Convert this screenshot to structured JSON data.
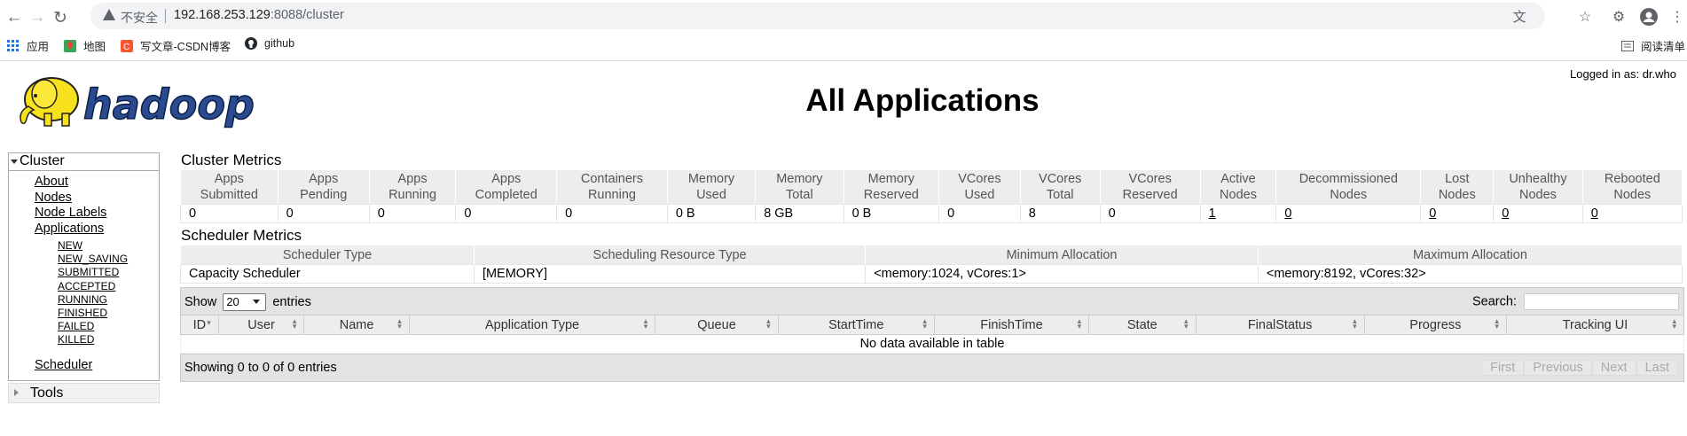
{
  "browser": {
    "insecure_label": "不安全",
    "url_host": "192.168.253.129",
    "url_rest": ":8088/cluster",
    "bookmarks": [
      "应用",
      "地图",
      "写文章-CSDN博客",
      "github"
    ],
    "reading_list": "阅读清单"
  },
  "header": {
    "title": "All Applications",
    "logged_in": "Logged in as: dr.who",
    "logo_text": "hadoop"
  },
  "sidebar": {
    "cluster_label": "Cluster",
    "links": [
      "About",
      "Nodes",
      "Node Labels",
      "Applications"
    ],
    "app_states": [
      "NEW",
      "NEW_SAVING",
      "SUBMITTED",
      "ACCEPTED",
      "RUNNING",
      "FINISHED",
      "FAILED",
      "KILLED"
    ],
    "scheduler_label": "Scheduler",
    "tools_label": "Tools"
  },
  "cluster_metrics": {
    "title": "Cluster Metrics",
    "headers": [
      [
        "Apps",
        "Submitted"
      ],
      [
        "Apps",
        "Pending"
      ],
      [
        "Apps",
        "Running"
      ],
      [
        "Apps",
        "Completed"
      ],
      [
        "Containers",
        "Running"
      ],
      [
        "Memory",
        "Used"
      ],
      [
        "Memory",
        "Total"
      ],
      [
        "Memory",
        "Reserved"
      ],
      [
        "VCores",
        "Used"
      ],
      [
        "VCores",
        "Total"
      ],
      [
        "VCores",
        "Reserved"
      ],
      [
        "Active",
        "Nodes"
      ],
      [
        "Decommissioned",
        "Nodes"
      ],
      [
        "Lost",
        "Nodes"
      ],
      [
        "Unhealthy",
        "Nodes"
      ],
      [
        "Rebooted",
        "Nodes"
      ]
    ],
    "values": [
      "0",
      "0",
      "0",
      "0",
      "0",
      "0 B",
      "8 GB",
      "0 B",
      "0",
      "8",
      "0",
      "1",
      "0",
      "0",
      "0",
      "0"
    ]
  },
  "scheduler_metrics": {
    "title": "Scheduler Metrics",
    "headers": [
      "Scheduler Type",
      "Scheduling Resource Type",
      "Minimum Allocation",
      "Maximum Allocation"
    ],
    "values": [
      "Capacity Scheduler",
      "[MEMORY]",
      "<memory:1024, vCores:1>",
      "<memory:8192, vCores:32>"
    ]
  },
  "apps_table": {
    "show_label": "Show",
    "entries_value": "20",
    "entries_label": "entries",
    "search_label": "Search:",
    "columns": [
      "ID",
      "User",
      "Name",
      "Application Type",
      "Queue",
      "StartTime",
      "FinishTime",
      "State",
      "FinalStatus",
      "Progress",
      "Tracking UI"
    ],
    "empty_message": "No data available in table",
    "info": "Showing 0 to 0 of 0 entries",
    "pager": [
      "First",
      "Previous",
      "Next",
      "Last"
    ]
  }
}
